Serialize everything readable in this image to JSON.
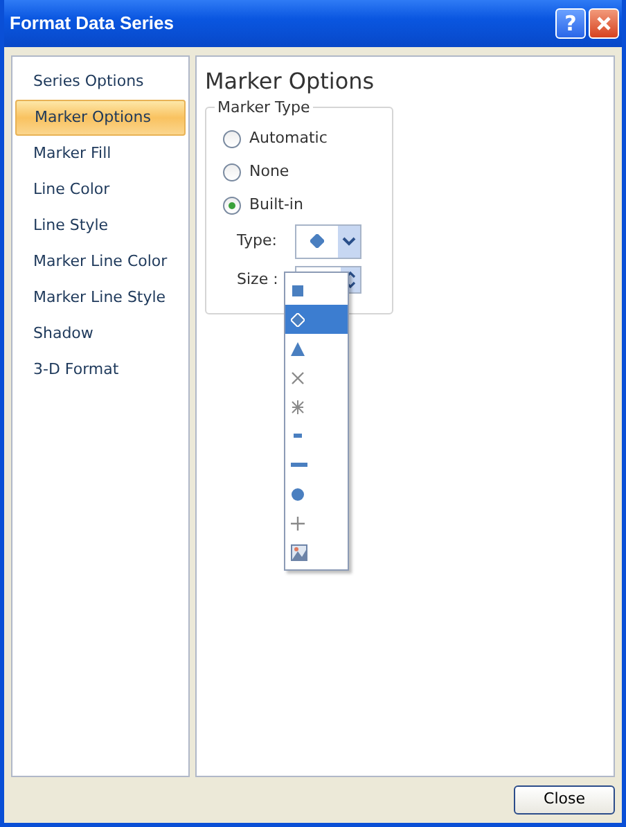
{
  "window": {
    "title": "Format Data Series",
    "buttons": [
      {
        "kind": "help",
        "label": "?"
      },
      {
        "kind": "close"
      }
    ]
  },
  "sidebar": {
    "items": [
      {
        "label": "Series Options",
        "selected": false
      },
      {
        "label": "Marker Options",
        "selected": true
      },
      {
        "label": "Marker Fill",
        "selected": false
      },
      {
        "label": "Line Color",
        "selected": false
      },
      {
        "label": "Line Style",
        "selected": false
      },
      {
        "label": "Marker Line Color",
        "selected": false
      },
      {
        "label": "Marker Line Style",
        "selected": false
      },
      {
        "label": "Shadow",
        "selected": false
      },
      {
        "label": "3-D Format",
        "selected": false
      }
    ]
  },
  "panel": {
    "title": "Marker Options",
    "group": {
      "legend": "Marker Type",
      "options": [
        {
          "label": "Automatic",
          "selected": false
        },
        {
          "label": "None",
          "selected": false
        },
        {
          "label": "Built-in",
          "selected": true
        }
      ],
      "type_label": "Type:",
      "type_marker": {
        "kind": "diamond"
      },
      "size_label": "Size :",
      "dropdown": {
        "items": [
          {
            "kind": "square",
            "selected": false
          },
          {
            "kind": "diamond",
            "selected": true
          },
          {
            "kind": "triangle",
            "selected": false
          },
          {
            "kind": "x",
            "selected": false
          },
          {
            "kind": "star",
            "selected": false
          },
          {
            "kind": "short-dash",
            "selected": false
          },
          {
            "kind": "long-dash",
            "selected": false
          },
          {
            "kind": "circle",
            "selected": false
          },
          {
            "kind": "plus",
            "selected": false
          },
          {
            "kind": "picture",
            "selected": false
          }
        ]
      }
    }
  },
  "footer": {
    "button": "Close"
  }
}
